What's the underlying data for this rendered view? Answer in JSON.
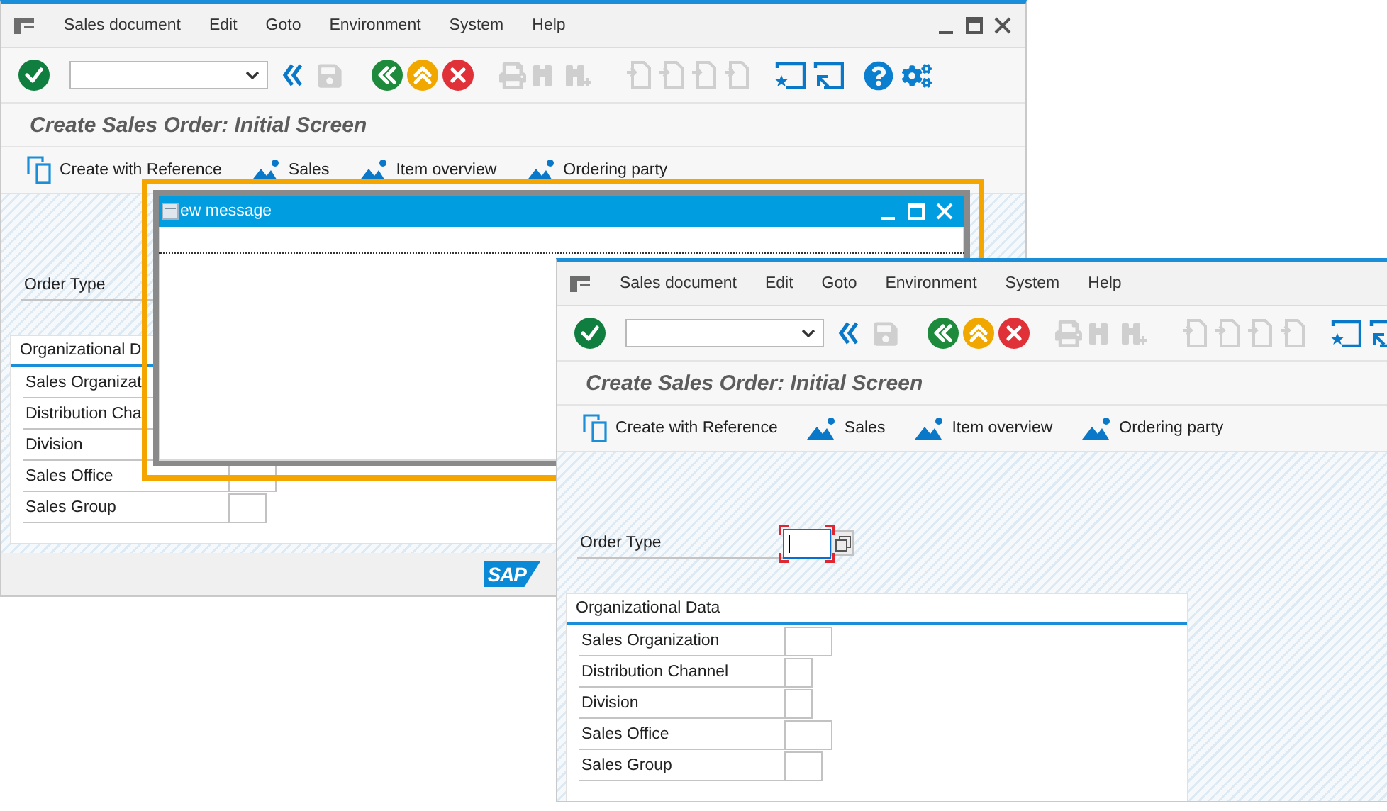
{
  "back_window": {
    "menu": [
      "Sales document",
      "Edit",
      "Goto",
      "Environment",
      "System",
      "Help"
    ],
    "title": "Create Sales Order: Initial Screen",
    "app_toolbar": [
      {
        "kind": "reference",
        "label": "Create with Reference"
      },
      {
        "kind": "overview",
        "label": "Sales"
      },
      {
        "kind": "overview",
        "label": "Item overview"
      },
      {
        "kind": "overview",
        "label": "Ordering party"
      }
    ],
    "order_type": {
      "label": "Order Type"
    },
    "group": {
      "title": "Organizational D",
      "rows": [
        "Sales Organizat",
        "Distribution Cha",
        "Division",
        "Sales Office",
        "Sales Group"
      ]
    },
    "logo": "SAP"
  },
  "dialog": {
    "title": "ew message"
  },
  "front_window": {
    "menu": [
      "Sales document",
      "Edit",
      "Goto",
      "Environment",
      "System",
      "Help"
    ],
    "title": "Create Sales Order: Initial Screen",
    "app_toolbar": [
      {
        "kind": "reference",
        "label": "Create with Reference"
      },
      {
        "kind": "overview",
        "label": "Sales"
      },
      {
        "kind": "overview",
        "label": "Item overview"
      },
      {
        "kind": "overview",
        "label": "Ordering party"
      }
    ],
    "order_type": {
      "label": "Order Type",
      "focused": true
    },
    "group": {
      "title": "Organizational Data",
      "rows": [
        "Sales Organization",
        "Distribution Channel",
        "Division",
        "Sales Office",
        "Sales Group"
      ]
    }
  }
}
